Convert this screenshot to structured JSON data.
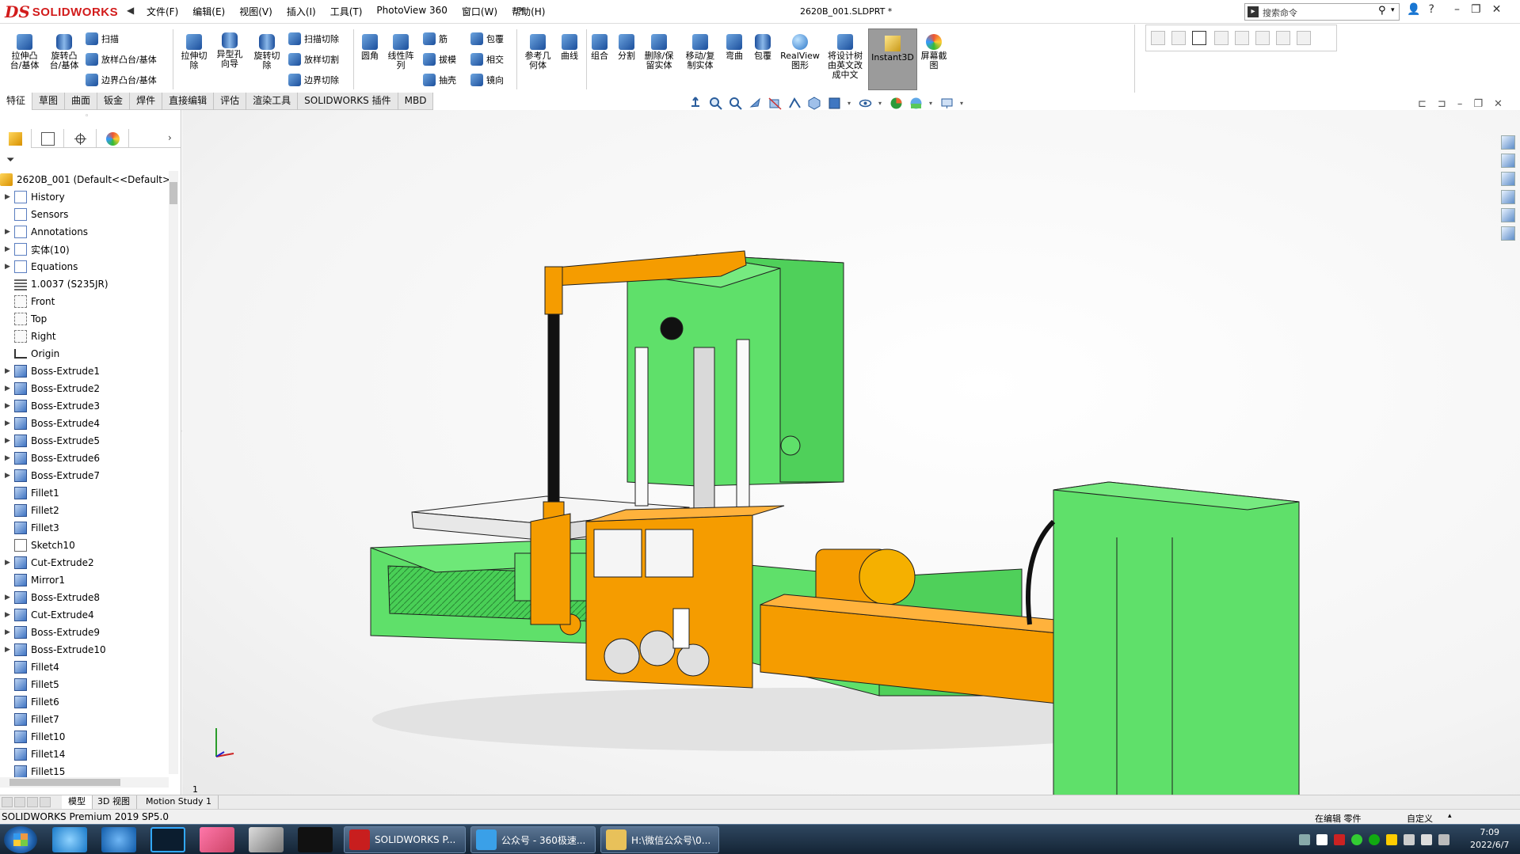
{
  "title_bar": {
    "logo_ds": "DS",
    "logo_text": "SOLIDWORKS",
    "menu": [
      "文件(F)",
      "编辑(E)",
      "视图(V)",
      "插入(I)",
      "工具(T)",
      "PhotoView 360",
      "窗口(W)",
      "帮助(H)"
    ],
    "document_title": "2620B_001.SLDPRT *",
    "search_placeholder": "搜索命令",
    "help_label": "?"
  },
  "ribbon": {
    "extrude_boss": "拉伸凸\n台/基体",
    "revolve_boss": "旋转凸\n台/基体",
    "sweep": "扫描",
    "loft": "放样凸台/基体",
    "boundary": "边界凸台/基体",
    "extrude_cut": "拉伸切\n除",
    "hole_wizard": "异型孔\n向导",
    "revolve_cut": "旋转切\n除",
    "swept_cut": "扫描切除",
    "lofted_cut": "放样切割",
    "boundary_cut": "边界切除",
    "fillet": "圆角",
    "linear_pattern": "线性阵\n列",
    "rib": "筋",
    "draft": "拔模",
    "shell": "抽壳",
    "wrap": "包覆",
    "intersect": "相交",
    "mirror": "镜向",
    "ref_geometry": "参考几\n何体",
    "curves": "曲线",
    "combine": "组合",
    "split": "分割",
    "delete_keep_body": "删除/保\n留实体",
    "move_copy_body": "移动/复\n制实体",
    "flex": "弯曲",
    "wrap2": "包覆",
    "realview": "RealView\n图形",
    "translate_tree": "将设计树\n由英文改\n成中文",
    "instant3d": "Instant3D",
    "screenshot": "屏幕截\n图"
  },
  "tabs": [
    "特征",
    "草图",
    "曲面",
    "钣金",
    "焊件",
    "直接编辑",
    "评估",
    "渲染工具",
    "SOLIDWORKS 插件",
    "MBD"
  ],
  "active_tab": "特征",
  "feature_tree": {
    "root": "2620B_001  (Default<<Default>",
    "items": [
      {
        "label": "History",
        "icon": "folder-icon",
        "expandable": true
      },
      {
        "label": "Sensors",
        "icon": "folder-icon",
        "expandable": false
      },
      {
        "label": "Annotations",
        "icon": "annotation-icon",
        "expandable": true
      },
      {
        "label": "实体(10)",
        "icon": "folder-icon",
        "expandable": true
      },
      {
        "label": "Equations",
        "icon": "equation-icon",
        "expandable": true
      },
      {
        "label": "1.0037 (S235JR)",
        "icon": "material-icon",
        "expandable": false
      },
      {
        "label": "Front",
        "icon": "plane-icon",
        "expandable": false
      },
      {
        "label": "Top",
        "icon": "plane-icon",
        "expandable": false
      },
      {
        "label": "Right",
        "icon": "plane-icon",
        "expandable": false
      },
      {
        "label": "Origin",
        "icon": "origin-icon",
        "expandable": false
      },
      {
        "label": "Boss-Extrude1",
        "icon": "feature-icon",
        "expandable": true
      },
      {
        "label": "Boss-Extrude2",
        "icon": "feature-icon",
        "expandable": true
      },
      {
        "label": "Boss-Extrude3",
        "icon": "feature-icon",
        "expandable": true
      },
      {
        "label": "Boss-Extrude4",
        "icon": "feature-icon",
        "expandable": true
      },
      {
        "label": "Boss-Extrude5",
        "icon": "feature-icon",
        "expandable": true
      },
      {
        "label": "Boss-Extrude6",
        "icon": "feature-icon",
        "expandable": true
      },
      {
        "label": "Boss-Extrude7",
        "icon": "feature-icon",
        "expandable": true
      },
      {
        "label": "Fillet1",
        "icon": "feature-icon",
        "expandable": false
      },
      {
        "label": "Fillet2",
        "icon": "feature-icon",
        "expandable": false
      },
      {
        "label": "Fillet3",
        "icon": "feature-icon",
        "expandable": false
      },
      {
        "label": "Sketch10",
        "icon": "sketch-icon",
        "expandable": false
      },
      {
        "label": "Cut-Extrude2",
        "icon": "feature-icon",
        "expandable": true
      },
      {
        "label": "Mirror1",
        "icon": "feature-icon",
        "expandable": false
      },
      {
        "label": "Boss-Extrude8",
        "icon": "feature-icon",
        "expandable": true
      },
      {
        "label": "Cut-Extrude4",
        "icon": "feature-icon",
        "expandable": true
      },
      {
        "label": "Boss-Extrude9",
        "icon": "feature-icon",
        "expandable": true
      },
      {
        "label": "Boss-Extrude10",
        "icon": "feature-icon",
        "expandable": true
      },
      {
        "label": "Fillet4",
        "icon": "feature-icon",
        "expandable": false
      },
      {
        "label": "Fillet5",
        "icon": "feature-icon",
        "expandable": false
      },
      {
        "label": "Fillet6",
        "icon": "feature-icon",
        "expandable": false
      },
      {
        "label": "Fillet7",
        "icon": "feature-icon",
        "expandable": false
      },
      {
        "label": "Fillet10",
        "icon": "feature-icon",
        "expandable": false
      },
      {
        "label": "Fillet14",
        "icon": "feature-icon",
        "expandable": false
      },
      {
        "label": "Fillet15",
        "icon": "feature-icon",
        "expandable": false
      }
    ]
  },
  "viewport": {
    "corner_label": "1",
    "model_colors": {
      "body": "#5fe06a",
      "body_dark": "#3cb548",
      "accent": "#f59c00",
      "accent_dark": "#c87a00",
      "outline": "#1f1f1f"
    }
  },
  "bottom_tabs": [
    "模型",
    "3D 视图",
    "Motion Study 1"
  ],
  "active_bottom_tab": "模型",
  "status_bar": {
    "app_name": "SOLIDWORKS Premium 2019 SP5.0",
    "editing": "在编辑 零件",
    "units": "自定义"
  },
  "taskbar": {
    "apps": [
      {
        "label": "SOLIDWORKS P...",
        "icon": "solidworks-icon",
        "color": "#c81e1e"
      },
      {
        "label": "公众号 - 360极速...",
        "icon": "browser-icon",
        "color": "#3aa0e8"
      },
      {
        "label": "H:\\微信公众号\\0...",
        "icon": "folder-icon",
        "color": "#e8c15a"
      }
    ],
    "time": "7:09",
    "date": "2022/6/7"
  }
}
